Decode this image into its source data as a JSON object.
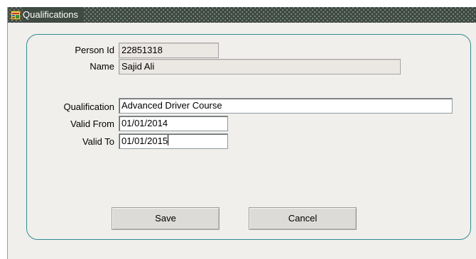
{
  "window": {
    "title": "Qualifications",
    "icon": "form-icon"
  },
  "form": {
    "person_id_label": "Person Id",
    "person_id_value": "22851318",
    "name_label": "Name",
    "name_value": "Sajid Ali",
    "qualification_label": "Qualification",
    "qualification_value": "Advanced Driver Course",
    "valid_from_label": "Valid From",
    "valid_from_value": "01/01/2014",
    "valid_to_label": "Valid To",
    "valid_to_value": "01/01/2015"
  },
  "buttons": {
    "save_label": "Save",
    "cancel_label": "Cancel"
  },
  "colors": {
    "titlebar": "#3f4a43",
    "panel_border": "#2f8a8f",
    "window_background": "#f1efec"
  }
}
